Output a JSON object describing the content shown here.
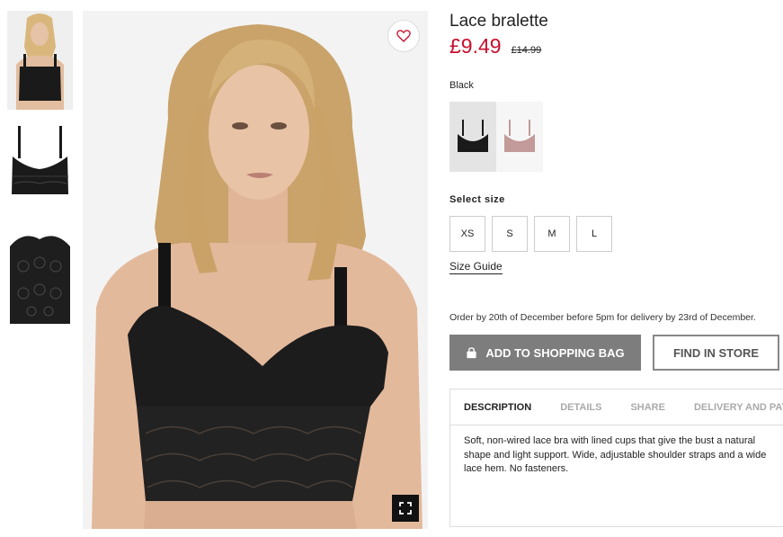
{
  "product": {
    "title": "Lace bralette",
    "price": "£9.49",
    "old_price": "£14.99"
  },
  "thumbnails": [
    {
      "name": "model-photo"
    },
    {
      "name": "product-front"
    },
    {
      "name": "lace-detail"
    }
  ],
  "color": {
    "selected_label": "Black",
    "swatches": [
      {
        "name": "black",
        "color": "#1a1a1a"
      },
      {
        "name": "pink",
        "color": "#c29a99"
      }
    ]
  },
  "size": {
    "label": "Select size",
    "options": [
      "XS",
      "S",
      "M",
      "L"
    ],
    "guide_label": "Size Guide"
  },
  "delivery_note": "Order by 20th of December before 5pm for delivery by 23rd of December.",
  "actions": {
    "add_to_bag": "ADD TO SHOPPING BAG",
    "find_in_store": "FIND IN STORE"
  },
  "tabs": {
    "items": [
      "DESCRIPTION",
      "DETAILS",
      "SHARE",
      "DELIVERY AND PAYMENT"
    ],
    "active": "DESCRIPTION",
    "description": "Soft, non-wired lace bra with lined cups that give the bust a natural shape and light support. Wide, adjustable shoulder straps and a wide lace hem. No fasteners."
  },
  "colors": {
    "price_red": "#c8102e",
    "bag_button": "#7d7d7d"
  }
}
